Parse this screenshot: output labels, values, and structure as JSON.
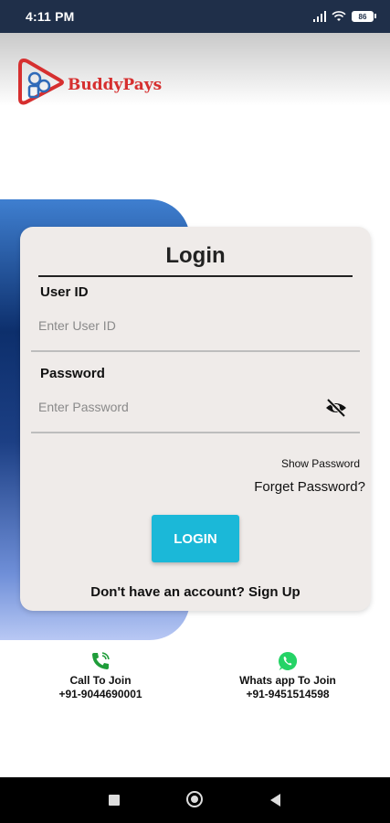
{
  "status_bar": {
    "time": "4:11 PM",
    "battery": "86"
  },
  "brand": {
    "name": "BuddyPays",
    "accent": "#d62f2f",
    "logo_icon": "play-logo-icon"
  },
  "login": {
    "title": "Login",
    "user_id_label": "User ID",
    "user_id_placeholder": "Enter User ID",
    "password_label": "Password",
    "password_placeholder": "Enter Password",
    "show_password": "Show Password",
    "forget_password": "Forget Password?",
    "login_button": "LOGIN",
    "signup_text": "Don't have an account? Sign Up",
    "button_color": "#1bb8d8"
  },
  "contacts": {
    "call": {
      "label": "Call To Join",
      "number": "+91-9044690001",
      "icon": "phone-icon"
    },
    "whatsapp": {
      "label": "Whats app To Join",
      "number": "+91-9451514598",
      "icon": "whatsapp-icon"
    }
  },
  "nav": {
    "icons": [
      "recents-square-icon",
      "home-circle-icon",
      "back-triangle-icon"
    ]
  }
}
